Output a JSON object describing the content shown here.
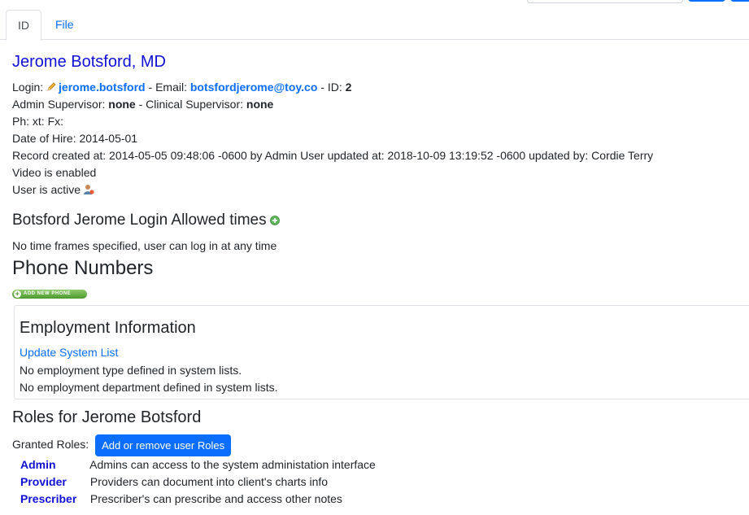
{
  "tabs": {
    "id_label": "ID",
    "file_label": "File"
  },
  "user": {
    "name": "Jerome Botsford, MD",
    "login_label": "Login:",
    "login": "jerome.botsford",
    "email_label": "- Email:",
    "email": "botsfordjerome@toy.co",
    "id_label": "- ID:",
    "id": "2",
    "admin_sup_label": "Admin Supervisor:",
    "admin_sup": "none",
    "clin_sup_label": "- Clinical Supervisor:",
    "clin_sup": "none",
    "phone_line": "Ph: xt: Fx:",
    "hire_line": "Date of Hire: 2014-05-01",
    "record_line": "Record created at: 2014-05-05 09:48:06 -0600 by Admin User updated at: 2018-10-09 13:19:52 -0600 updated by: Cordie Terry",
    "video_line": "Video is enabled",
    "active_line": "User is active"
  },
  "allowed": {
    "title": "Botsford Jerome Login Allowed times",
    "text": "No time frames specified, user can log in at any time"
  },
  "phones": {
    "title": "Phone Numbers",
    "add_label": "ADD NEW PHONE"
  },
  "employment": {
    "title": "Employment Information",
    "update_link": "Update System List",
    "type_text": "No employment type defined in system lists.",
    "dept_text": "No employment department defined in system lists."
  },
  "roles": {
    "title": "Roles for Jerome Botsford",
    "granted_label": "Granted Roles:",
    "button_label": "Add or remove user Roles",
    "items": [
      {
        "name": "Admin",
        "desc": "Admins can access to the system administation interface"
      },
      {
        "name": "Provider",
        "desc": "Providers can document into client's charts info"
      },
      {
        "name": "Prescriber",
        "desc": "Prescriber's can prescribe and access other notes"
      }
    ]
  },
  "colors": {
    "link": "#0b6efd",
    "name": "#1010d6",
    "addphone_green": "#4e9a2e"
  },
  "icons": [
    "pencil-icon",
    "user-active-icon",
    "add-plus-icon"
  ]
}
